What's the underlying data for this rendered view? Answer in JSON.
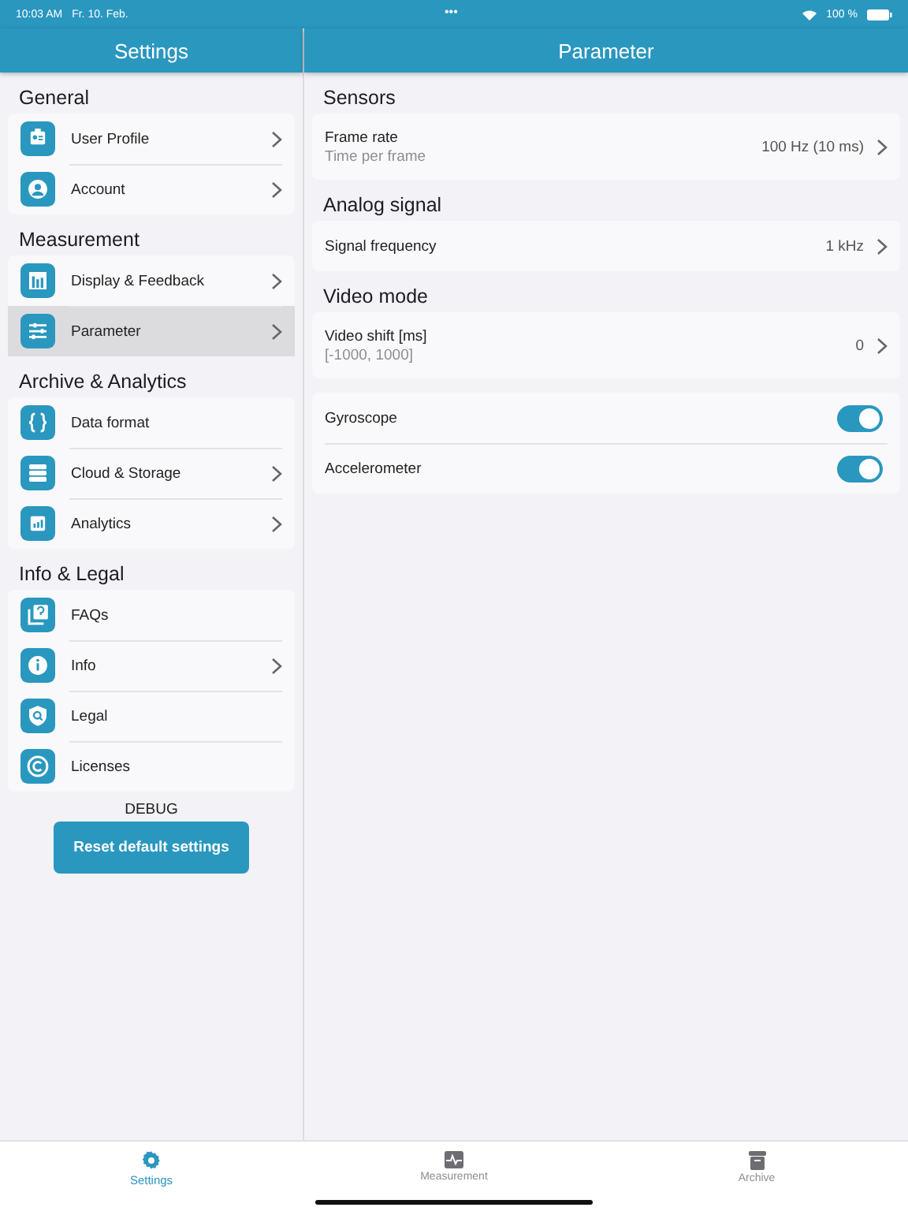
{
  "status_bar": {
    "time": "10:03 AM",
    "date": "Fr. 10. Feb.",
    "dots": "•••",
    "battery": "100 %"
  },
  "sidebar": {
    "title": "Settings",
    "sections": [
      {
        "title": "General",
        "items": [
          {
            "label": "User Profile",
            "chevron": true,
            "selected": false
          },
          {
            "label": "Account",
            "chevron": true,
            "selected": false
          }
        ]
      },
      {
        "title": "Measurement",
        "items": [
          {
            "label": "Display & Feedback",
            "chevron": true,
            "selected": false
          },
          {
            "label": "Parameter",
            "chevron": true,
            "selected": true
          }
        ]
      },
      {
        "title": "Archive & Analytics",
        "items": [
          {
            "label": "Data format",
            "chevron": false,
            "selected": false
          },
          {
            "label": "Cloud & Storage",
            "chevron": true,
            "selected": false
          },
          {
            "label": "Analytics",
            "chevron": true,
            "selected": false
          }
        ]
      },
      {
        "title": "Info & Legal",
        "items": [
          {
            "label": "FAQs",
            "chevron": false,
            "selected": false
          },
          {
            "label": "Info",
            "chevron": true,
            "selected": false
          },
          {
            "label": "Legal",
            "chevron": false,
            "selected": false
          },
          {
            "label": "Licenses",
            "chevron": false,
            "selected": false
          }
        ]
      }
    ],
    "debug_label": "DEBUG",
    "reset_button": "Reset default settings"
  },
  "detail": {
    "title": "Parameter",
    "sections": [
      {
        "title": "Sensors",
        "rows": [
          {
            "kind": "value",
            "label": "Frame rate",
            "subtitle": "Time per frame",
            "value": "100 Hz (10 ms)"
          }
        ]
      },
      {
        "title": "Analog signal",
        "rows": [
          {
            "kind": "value",
            "label": "Signal frequency",
            "value": "1 kHz"
          }
        ]
      },
      {
        "title": "Video mode",
        "rows": [
          {
            "kind": "value",
            "label": "Video shift [ms]",
            "subtitle": "[-1000, 1000]",
            "value": "0"
          }
        ]
      },
      {
        "rows": [
          {
            "kind": "toggle",
            "label": "Gyroscope",
            "on": true
          },
          {
            "kind": "toggle",
            "label": "Accelerometer",
            "on": true
          }
        ]
      }
    ]
  },
  "tab_bar": [
    {
      "label": "Settings",
      "selected": true
    },
    {
      "label": "Measurement",
      "selected": false
    },
    {
      "label": "Archive",
      "selected": false
    }
  ]
}
